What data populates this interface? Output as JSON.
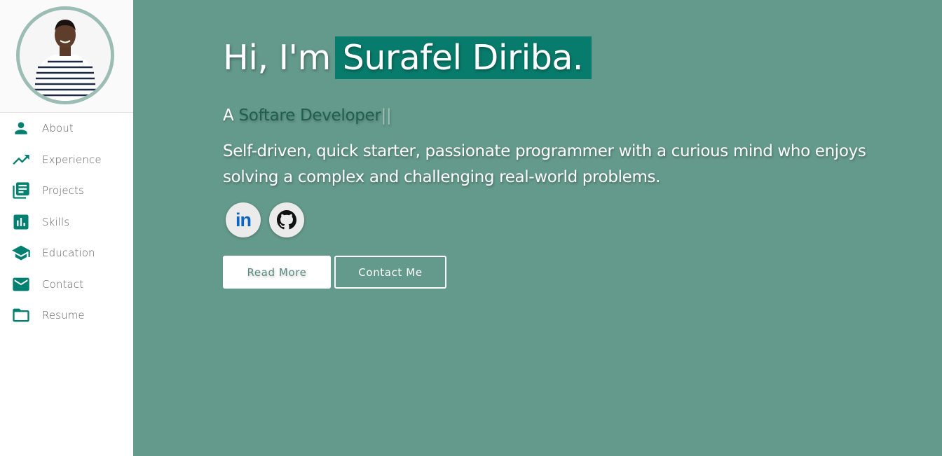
{
  "sidebar": {
    "items": [
      {
        "label": "About",
        "icon": "person-icon"
      },
      {
        "label": "Experience",
        "icon": "trending-up-icon"
      },
      {
        "label": "Projects",
        "icon": "library-books-icon"
      },
      {
        "label": "Skills",
        "icon": "bar-chart-icon"
      },
      {
        "label": "Education",
        "icon": "graduation-cap-icon"
      },
      {
        "label": "Contact",
        "icon": "mail-icon"
      },
      {
        "label": "Resume",
        "icon": "folder-icon"
      }
    ]
  },
  "hero": {
    "greeting": "Hi, I'm",
    "name": "Surafel Diriba.",
    "role_prefix": "A",
    "role_typed": "Softare Developer",
    "cursor": "||",
    "description": "Self-driven, quick starter, passionate programmer with a curious mind who enjoys solving a complex and challenging real-world problems."
  },
  "social": {
    "linkedin_label": "in",
    "linkedin_icon": "linkedin-icon",
    "github_icon": "github-icon"
  },
  "buttons": {
    "read_more": "Read More",
    "contact_me": "Contact Me"
  },
  "colors": {
    "accent": "#008070",
    "main_bg": "#649a8b",
    "name_highlight": "#087c6c",
    "avatar_ring": "#9cbdb4"
  }
}
